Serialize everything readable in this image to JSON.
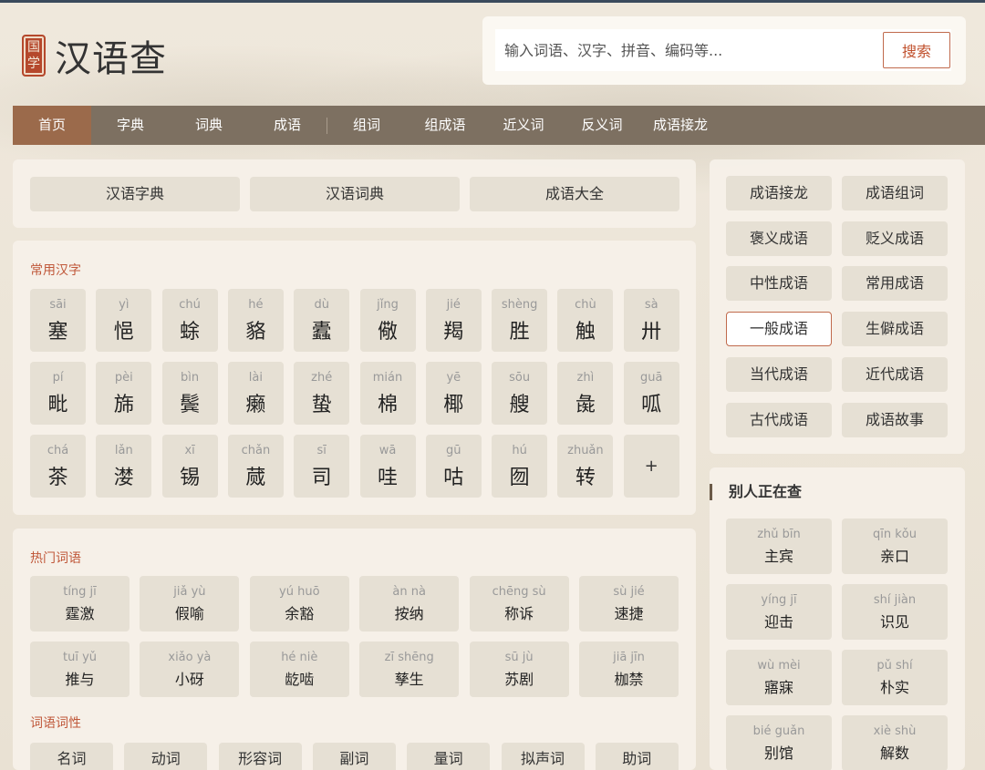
{
  "header": {
    "seal_top": "国",
    "seal_bottom": "学",
    "site_title": "汉语查",
    "search_placeholder": "输入词语、汉字、拼音、编码等...",
    "search_button": "搜索"
  },
  "nav": [
    "首页",
    "字典",
    "词典",
    "成语",
    "组词",
    "组成语",
    "近义词",
    "反义词",
    "成语接龙"
  ],
  "top_links": [
    "汉语字典",
    "汉语词典",
    "成语大全"
  ],
  "common_chars": {
    "title": "常用汉字",
    "items": [
      {
        "py": "sāi",
        "ch": "塞"
      },
      {
        "py": "yì",
        "ch": "悒"
      },
      {
        "py": "chú",
        "ch": "蜍"
      },
      {
        "py": "hé",
        "ch": "貉"
      },
      {
        "py": "dù",
        "ch": "蠹"
      },
      {
        "py": "jǐng",
        "ch": "儆"
      },
      {
        "py": "jié",
        "ch": "羯"
      },
      {
        "py": "shèng",
        "ch": "胜"
      },
      {
        "py": "chù",
        "ch": "触"
      },
      {
        "py": "sà",
        "ch": "卅"
      },
      {
        "py": "pí",
        "ch": "毗"
      },
      {
        "py": "pèi",
        "ch": "旆"
      },
      {
        "py": "bìn",
        "ch": "鬓"
      },
      {
        "py": "lài",
        "ch": "癞"
      },
      {
        "py": "zhé",
        "ch": "蛰"
      },
      {
        "py": "mián",
        "ch": "棉"
      },
      {
        "py": "yē",
        "ch": "椰"
      },
      {
        "py": "sōu",
        "ch": "艘"
      },
      {
        "py": "zhì",
        "ch": "彘"
      },
      {
        "py": "guā",
        "ch": "呱"
      },
      {
        "py": "chá",
        "ch": "茶"
      },
      {
        "py": "lǎn",
        "ch": "漤"
      },
      {
        "py": "xī",
        "ch": "锡"
      },
      {
        "py": "chǎn",
        "ch": "蒇"
      },
      {
        "py": "sī",
        "ch": "司"
      },
      {
        "py": "wā",
        "ch": "哇"
      },
      {
        "py": "gū",
        "ch": "咕"
      },
      {
        "py": "hú",
        "ch": "囫"
      },
      {
        "py": "zhuǎn",
        "ch": "转"
      }
    ],
    "more": "+"
  },
  "hot_words": {
    "title": "热门词语",
    "items": [
      {
        "py": "tíng jī",
        "w": "霆激"
      },
      {
        "py": "jiǎ yù",
        "w": "假喻"
      },
      {
        "py": "yú huō",
        "w": "余豁"
      },
      {
        "py": "àn nà",
        "w": "按纳"
      },
      {
        "py": "chēng sù",
        "w": "称诉"
      },
      {
        "py": "sù jié",
        "w": "速捷"
      },
      {
        "py": "tuī yǔ",
        "w": "推与"
      },
      {
        "py": "xiǎo yà",
        "w": "小砑"
      },
      {
        "py": "hé niè",
        "w": "龁啮"
      },
      {
        "py": "zī shēng",
        "w": "孳生"
      },
      {
        "py": "sū jù",
        "w": "苏剧"
      },
      {
        "py": "jiā jīn",
        "w": "枷禁"
      }
    ]
  },
  "pos": {
    "title": "词语词性",
    "items": [
      "名词",
      "动词",
      "形容词",
      "副词",
      "量词",
      "拟声词",
      "助词"
    ]
  },
  "idioms": [
    "成语接龙",
    "成语组词",
    "褒义成语",
    "贬义成语",
    "中性成语",
    "常用成语",
    "一般成语",
    "生僻成语",
    "当代成语",
    "近代成语",
    "古代成语",
    "成语故事"
  ],
  "others": {
    "title": "别人正在查",
    "items": [
      {
        "py": "zhǔ bīn",
        "w": "主宾"
      },
      {
        "py": "qīn kǒu",
        "w": "亲口"
      },
      {
        "py": "yíng jī",
        "w": "迎击"
      },
      {
        "py": "shí jiàn",
        "w": "识见"
      },
      {
        "py": "wù mèi",
        "w": "寤寐"
      },
      {
        "py": "pǔ shí",
        "w": "朴实"
      },
      {
        "py": "bié guǎn",
        "w": "别馆"
      },
      {
        "py": "xiè shù",
        "w": "解数"
      }
    ]
  }
}
